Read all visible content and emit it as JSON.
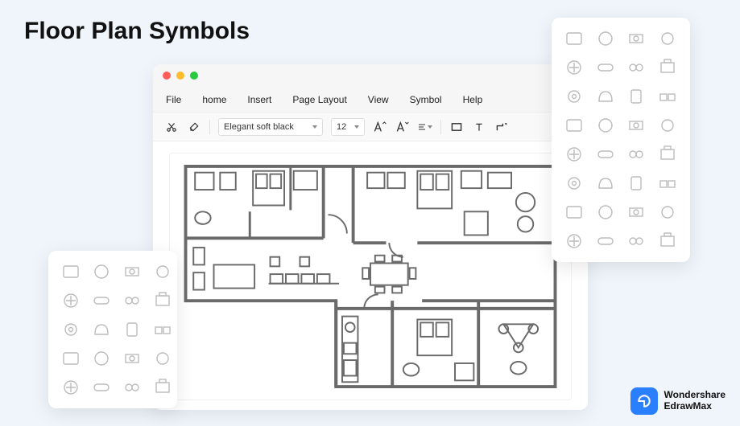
{
  "page": {
    "title": "Floor Plan Symbols"
  },
  "window": {
    "menu": {
      "file": "File",
      "home": "home",
      "insert": "Insert",
      "layout": "Page Layout",
      "view": "View",
      "symbol": "Symbol",
      "help": "Help"
    },
    "toolbar": {
      "font": "Elegant soft black",
      "size": "12"
    }
  },
  "brand": {
    "line1": "Wondershare",
    "line2": "EdrawMax"
  },
  "symbols_right": [
    "sofa-single",
    "chair-round",
    "chair-outline",
    "armchair",
    "circle-chair",
    "headrest",
    "lamp",
    "monitor",
    "desk",
    "table-square",
    "chair-side",
    "bench",
    "chair-wheels",
    "stool-bar",
    "stool-pair",
    "desk-double",
    "fan",
    "round-table",
    "dial",
    "round-table-2",
    "chair-side-2",
    "blob",
    "rect",
    "rect-2",
    "stool",
    "side-table",
    "square",
    "dining-round",
    "lounge",
    "settee",
    "double-chair",
    "round-seating"
  ],
  "symbols_left": [
    "corner-sofa",
    "desk-chair",
    "dining-4",
    "meeting-4",
    "round-6",
    "fan-top",
    "meeting-6",
    "table-pair",
    "meeting-8",
    "chair-top",
    "conference",
    "oval-table",
    "square-table",
    "round-table",
    "rect-table",
    "small-round",
    "chair",
    "round",
    "square-2",
    "blank"
  ]
}
